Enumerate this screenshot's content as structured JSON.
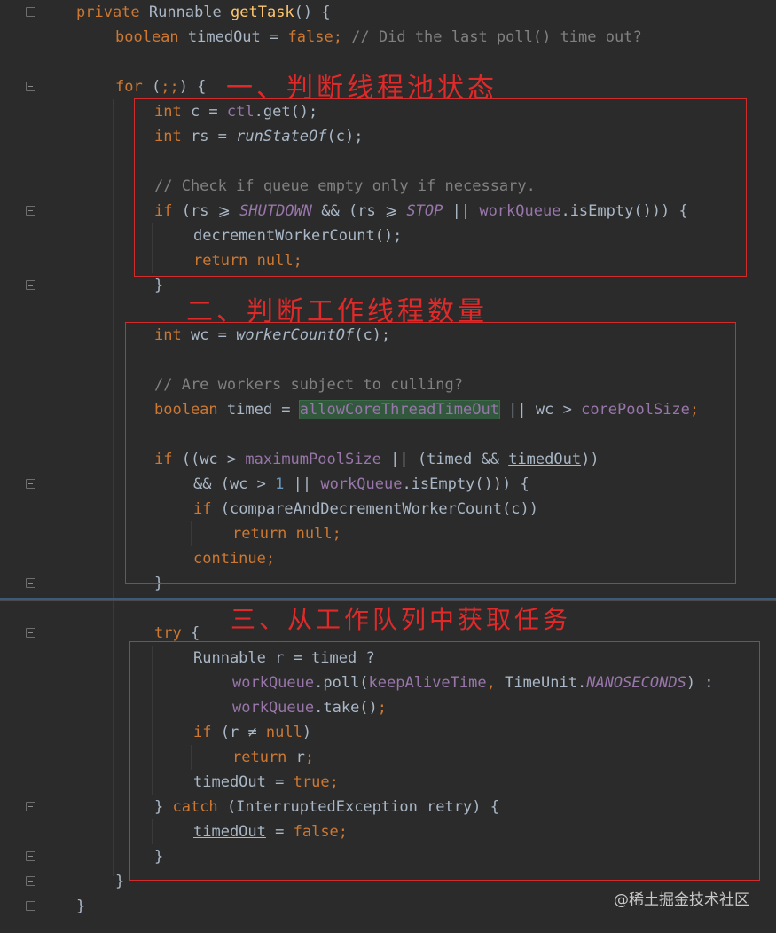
{
  "code": {
    "l1": {
      "kw": "private ",
      "type": "Runnable ",
      "fn": "getTask",
      "rest": "() {"
    },
    "l2": {
      "kw": "boolean ",
      "var": "timedOut",
      "eq": " = ",
      "val": "false",
      "semi": ";",
      "cmt": " // Did the last poll() time out?"
    },
    "l4": {
      "kw": "for ",
      "rest1": "(",
      "semis": ";;",
      "rest2": ") {"
    },
    "l5": {
      "kw": "int ",
      "rest": "c = ",
      "fld": "ctl",
      "rest2": ".get();"
    },
    "l6": {
      "kw": "int ",
      "rest": "rs = ",
      "fn": "runStateOf",
      "rest2": "(c);"
    },
    "l8": {
      "cmt": "// Check if queue empty only if necessary."
    },
    "l9": {
      "kw": "if ",
      "p1": "(rs ",
      "op1": "⩾ ",
      "c1": "SHUTDOWN",
      "p2": " && (rs ",
      "op2": "⩾ ",
      "c2": "STOP",
      "p3": " || ",
      "fld": "workQueue",
      "p4": ".isEmpty())) {"
    },
    "l10": {
      "text": "decrementWorkerCount();"
    },
    "l11": {
      "kw": "return ",
      "kw2": "null",
      "semi": ";"
    },
    "l12": {
      "text": "}"
    },
    "l13": {
      "kw": "int ",
      "rest": "wc = ",
      "fn": "workerCountOf",
      "rest2": "(c);"
    },
    "l15": {
      "cmt": "// Are workers subject to culling?"
    },
    "l16": {
      "kw": "boolean ",
      "rest": "timed = ",
      "hl": "allowCoreThreadTimeOut",
      "p1": " || wc > ",
      "fld": "corePoolSize",
      "semi": ";"
    },
    "l18": {
      "kw": "if ",
      "p1": "((wc > ",
      "fld": "maximumPoolSize",
      "p2": " || (timed && ",
      "var": "timedOut",
      "p3": "))"
    },
    "l19": {
      "p1": "&& (wc > ",
      "num": "1",
      "p2": " || ",
      "fld": "workQueue",
      "p3": ".isEmpty())) {"
    },
    "l20": {
      "kw": "if ",
      "p1": "(compareAndDecrementWorkerCount(c))"
    },
    "l21": {
      "kw": "return ",
      "kw2": "null",
      "semi": ";"
    },
    "l22": {
      "kw": "continue",
      "semi": ";"
    },
    "l23": {
      "text": "}"
    },
    "l25": {
      "kw": "try ",
      "rest": "{"
    },
    "l26": {
      "text": "Runnable r = timed ?"
    },
    "l27": {
      "fld": "workQueue",
      "p1": ".poll(",
      "fld2": "keepAliveTime",
      "semi": ", ",
      "p2": "TimeUnit.",
      "cst": "NANOSECONDS",
      "p3": ") :"
    },
    "l28": {
      "fld": "workQueue",
      "p1": ".take()",
      "semi": ";"
    },
    "l29": {
      "kw": "if ",
      "p1": "(r ",
      "op": "≠ ",
      "kw2": "null",
      "p2": ")"
    },
    "l30": {
      "kw": "return ",
      "p1": "r",
      "semi": ";"
    },
    "l31": {
      "var": "timedOut",
      "p1": " = ",
      "kw": "true",
      "semi": ";"
    },
    "l32": {
      "p1": "} ",
      "kw": "catch ",
      "p2": "(InterruptedException retry) {"
    },
    "l33": {
      "var": "timedOut",
      "p1": " = ",
      "kw": "false",
      "semi": ";"
    },
    "l34": {
      "text": "}"
    },
    "l35": {
      "text": "}"
    },
    "l36": {
      "text": "}"
    }
  },
  "annotations": {
    "a1": "一、判断线程池状态",
    "a2": "二、判断工作线程数量",
    "a3": "三、从工作队列中获取任务"
  },
  "watermark": "@稀土掘金技术社区",
  "colors": {
    "background": "#2b2b2b",
    "keyword": "#cc7832",
    "method": "#ffc66d",
    "field": "#9876aa",
    "comment": "#808080",
    "number": "#6897bb",
    "text": "#a9b7c6",
    "annotation": "#e02a2a"
  }
}
